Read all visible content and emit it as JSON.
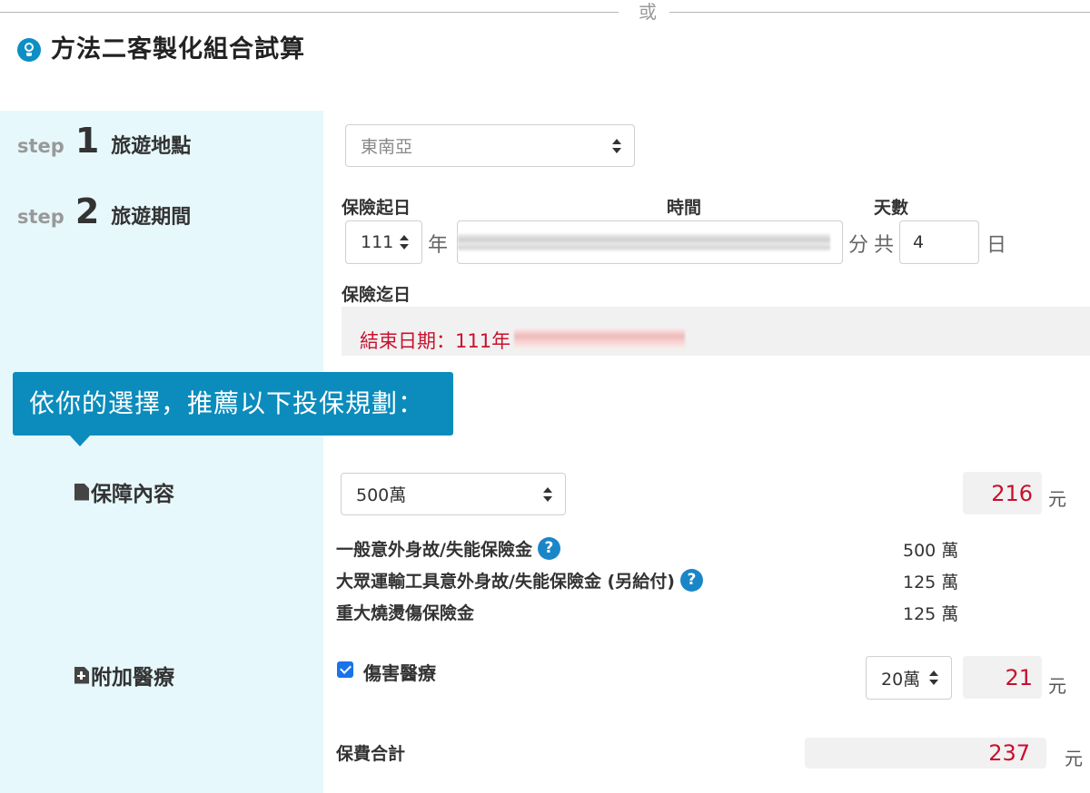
{
  "divider": {
    "text": "或"
  },
  "section": {
    "title": "方法二客製化組合試算",
    "icon": "lightbulb-icon",
    "accent_color": "#0d8fc4"
  },
  "steps": [
    {
      "word": "step",
      "number": "1",
      "label": "旅遊地點"
    },
    {
      "word": "step",
      "number": "2",
      "label": "旅遊期間"
    }
  ],
  "destination": {
    "selected": "東南亞"
  },
  "period": {
    "start_label": "保險起日",
    "time_label": "時間",
    "days_label": "天數",
    "year_value": "111",
    "year_unit": "年",
    "minute_unit": "分",
    "total_prefix": "共",
    "days_value": "4",
    "days_unit": "日",
    "end_label": "保險迄日",
    "end_date_text": "結束日期：111年"
  },
  "banner": {
    "text": "依你的選擇，推薦以下投保規劃：",
    "color": "#0b8cbc"
  },
  "coverage": {
    "label": "保障內容",
    "icon": "document-icon",
    "selected": "500萬",
    "price": "216",
    "currency": "元",
    "benefits": [
      {
        "name": "一般意外身故/失能保險金",
        "amount": "500 萬",
        "has_help": true
      },
      {
        "name": "大眾運輸工具意外身故/失能保險金 (另給付)",
        "amount": "125 萬",
        "has_help": true
      },
      {
        "name": "重大燒燙傷保險金",
        "amount": "125 萬",
        "has_help": false
      }
    ],
    "help_glyph": "?"
  },
  "medical": {
    "label": "附加醫療",
    "icon": "document-plus-icon",
    "checkbox_label": "傷害醫療",
    "checked": true,
    "selected": "20萬",
    "price": "21",
    "currency": "元"
  },
  "total": {
    "label": "保費合計",
    "value": "237",
    "currency": "元"
  },
  "colors": {
    "price_red": "#c8102e",
    "panel_bg": "#e6f8fc"
  }
}
